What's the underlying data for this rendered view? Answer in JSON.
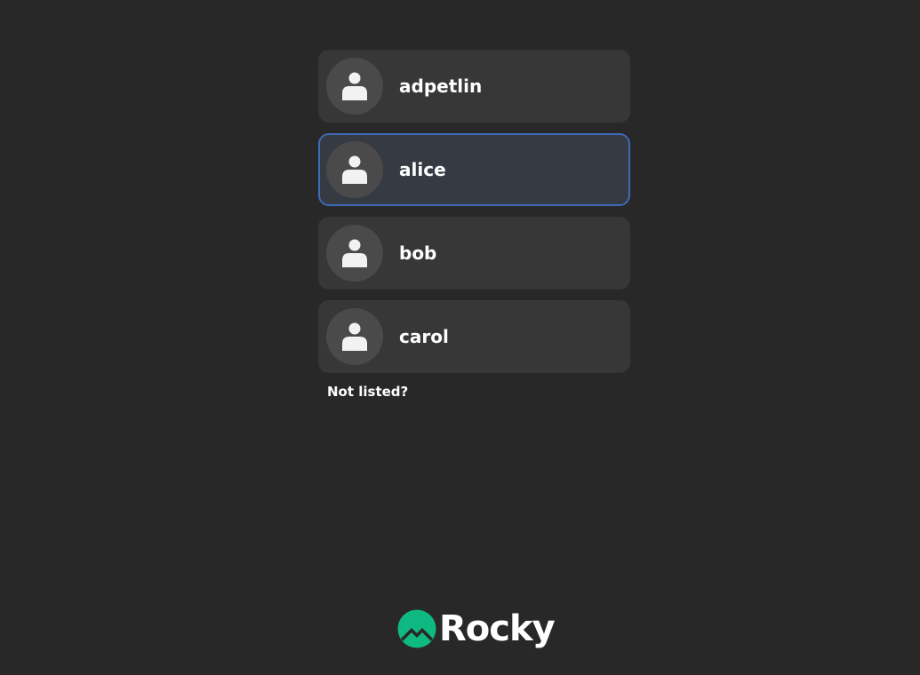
{
  "users": [
    {
      "name": "adpetlin",
      "selected": false
    },
    {
      "name": "alice",
      "selected": true
    },
    {
      "name": "bob",
      "selected": false
    },
    {
      "name": "carol",
      "selected": false
    }
  ],
  "not_listed_label": "Not listed?",
  "brand": {
    "name": "Rocky",
    "logo_icon": "rocky-logo-icon",
    "logo_color": "#10b981"
  },
  "colors": {
    "background": "#282828",
    "row": "#373737",
    "row_selected": "#363a42",
    "selected_border": "#3e6bb5",
    "avatar": "#4a4a4a"
  }
}
